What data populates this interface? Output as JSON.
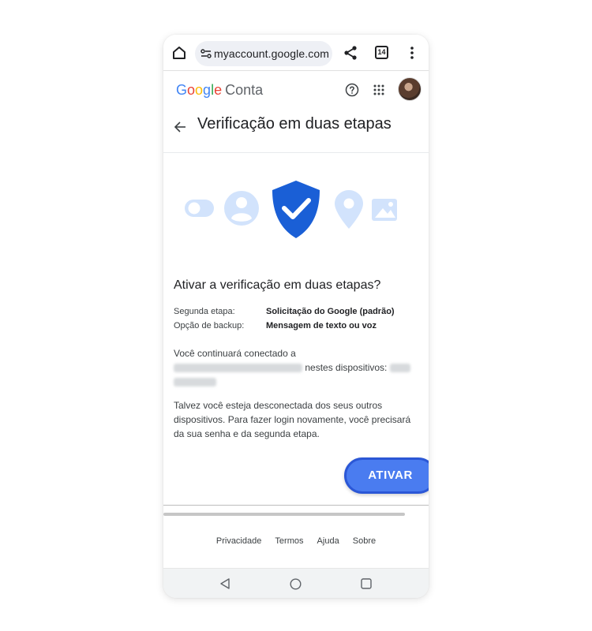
{
  "browser": {
    "url": "myaccount.google.com",
    "tab_count": "14",
    "icons": [
      "home-icon",
      "tune-icon",
      "share-icon",
      "tabs-icon",
      "more-vert-icon"
    ]
  },
  "header": {
    "logo_letters": [
      "G",
      "o",
      "o",
      "g",
      "l",
      "e"
    ],
    "product": "Conta",
    "icons": [
      "help-icon",
      "apps-icon",
      "avatar"
    ]
  },
  "page": {
    "title": "Verificação em duas etapas",
    "heading": "Ativar a verificação em duas etapas?",
    "details": [
      {
        "key": "Segunda etapa:",
        "value": "Solicitação do Google (padrão)"
      },
      {
        "key": "Opção de backup:",
        "value": "Mensagem de texto ou voz"
      }
    ],
    "connected_intro": "Você continuará conectado a",
    "connected_devices": "nestes dispositivos:",
    "notice": "Talvez você esteja desconectada dos seus outros dispositivos. Para fazer login novamente, você precisará da sua senha e da segunda etapa.",
    "activate_button": "ATIVAR"
  },
  "footer": {
    "links": [
      "Privacidade",
      "Termos",
      "Ajuda",
      "Sobre"
    ]
  },
  "colors": {
    "accent": "#4a7cf0",
    "accent_border": "#2b57d6",
    "shield": "#1a5fd6",
    "illustration_light": "#d2e3fc"
  }
}
